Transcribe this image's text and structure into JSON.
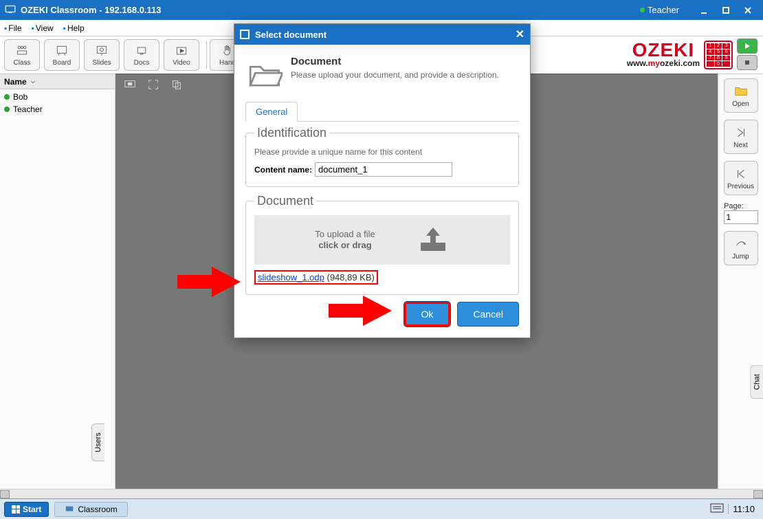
{
  "titlebar": {
    "app": "OZEKI Classroom",
    "ip": "192.168.0.113",
    "user": "Teacher"
  },
  "menu": {
    "file": "File",
    "view": "View",
    "help": "Help"
  },
  "toolbar": {
    "class": "Class",
    "board": "Board",
    "slides": "Slides",
    "docs": "Docs",
    "video": "Video",
    "hand": "Hand"
  },
  "brand": {
    "main": "OZEKI",
    "pre": "www.",
    "mid": "my",
    "post": "ozeki.com"
  },
  "left": {
    "header": "Name",
    "users": [
      "Bob",
      "Teacher"
    ],
    "tab": "Users"
  },
  "right": {
    "open": "Open",
    "next": "Next",
    "previous": "Previous",
    "page_label": "Page:",
    "page_value": "1",
    "jump": "Jump",
    "chat": "Chat"
  },
  "dialog": {
    "title": "Select document",
    "header": "Document",
    "desc": "Please upload your document, and provide a description.",
    "tab": "General",
    "fs1": {
      "legend": "Identification",
      "hint": "Please provide a unique name for this content",
      "label": "Content name:",
      "value": "document_1"
    },
    "fs2": {
      "legend": "Document",
      "upload1": "To upload a file",
      "upload2": "click or drag",
      "file": "slideshow_1.odp",
      "size": "(948,89 KB)"
    },
    "ok": "Ok",
    "cancel": "Cancel"
  },
  "taskbar": {
    "start": "Start",
    "classroom": "Classroom",
    "time": "11:10"
  }
}
